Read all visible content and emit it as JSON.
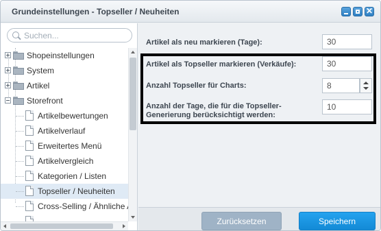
{
  "window": {
    "title": "Grundeinstellungen - Topseller / Neuheiten"
  },
  "search": {
    "placeholder": "Suchen..."
  },
  "tree": {
    "nodes": [
      {
        "label": "Shopeinstellungen",
        "type": "folder",
        "expanded": false
      },
      {
        "label": "System",
        "type": "folder",
        "expanded": false
      },
      {
        "label": "Artikel",
        "type": "folder",
        "expanded": false
      },
      {
        "label": "Storefront",
        "type": "folder",
        "expanded": true
      },
      {
        "label": "Artikelbewertungen",
        "type": "leaf"
      },
      {
        "label": "Artikelverlauf",
        "type": "leaf"
      },
      {
        "label": "Erweitertes Menü",
        "type": "leaf"
      },
      {
        "label": "Artikelvergleich",
        "type": "leaf"
      },
      {
        "label": "Kategorien / Listen",
        "type": "leaf"
      },
      {
        "label": "Topseller / Neuheiten",
        "type": "leaf",
        "selected": true
      },
      {
        "label": "Cross-Selling / Ähnliche Ar",
        "type": "leaf"
      }
    ]
  },
  "form": {
    "new_days_label": "Artikel als neu markieren (Tage):",
    "new_days_value": "30",
    "topseller_sales_label": "Artikel als Topseller markieren (Verkäufe):",
    "topseller_sales_value": "30",
    "charts_count_label": "Anzahl Topseller für Charts:",
    "charts_count_value": "8",
    "days_generation_label_1": "Anzahl der Tage, die für die Topseller-",
    "days_generation_label_2": "Generierung berücksichtigt werden:",
    "days_generation_value": "10"
  },
  "footer": {
    "reset_label": "Zurücksetzen",
    "save_label": "Speichern"
  },
  "colors": {
    "save_button": "#1a96e3",
    "reset_button": "#9fb3c6",
    "highlight_border": "#000000"
  }
}
